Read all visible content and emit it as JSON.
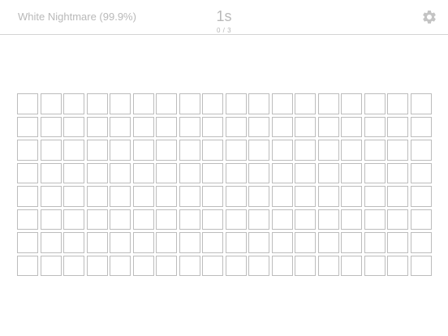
{
  "header": {
    "level_title": "White Nightmare (99.9%)",
    "timer": "1s",
    "progress": "0 / 3",
    "settings_icon": "gear-icon"
  },
  "board": {
    "columns": 18,
    "rows": 8,
    "revealed_tiles": 0
  },
  "colors": {
    "background": "#ffffff",
    "tile_border": "#bdbdbd",
    "header_text": "#b9b9b9",
    "divider": "#d4d4d4"
  }
}
